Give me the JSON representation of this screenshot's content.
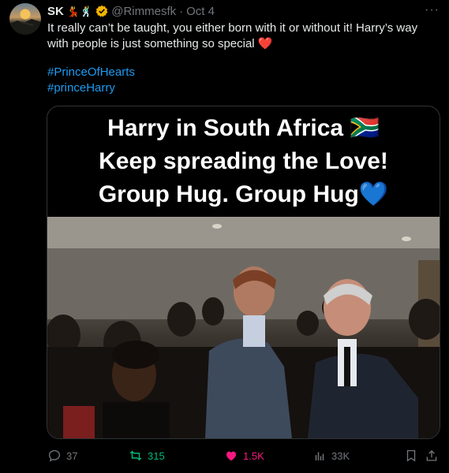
{
  "author": {
    "name": "SK",
    "emoji": "💃🕺",
    "handle": "@Rimmesfk",
    "separator": "·",
    "date": "Oct 4"
  },
  "more_label": "···",
  "tweet": {
    "text": "It really can’t be taught, you either born with it or without it! Harry’s way with people is just something so special",
    "heart_emoji": "❤️",
    "hashtags": [
      "#PrinceOfHearts",
      "#princeHarry"
    ]
  },
  "media": {
    "caption_lines": [
      "Harry in South Africa 🇿🇦",
      "Keep spreading the Love!",
      "Group Hug. Group Hug💙"
    ]
  },
  "actions": {
    "replies": "37",
    "retweets": "315",
    "likes": "1.5K",
    "views": "33K"
  },
  "colors": {
    "background": "#000000",
    "text": "#e7e9ea",
    "muted": "#71767b",
    "link": "#1d9bf0",
    "retweet": "#00ba7c",
    "like": "#f91880",
    "verified": "#f4b400"
  }
}
